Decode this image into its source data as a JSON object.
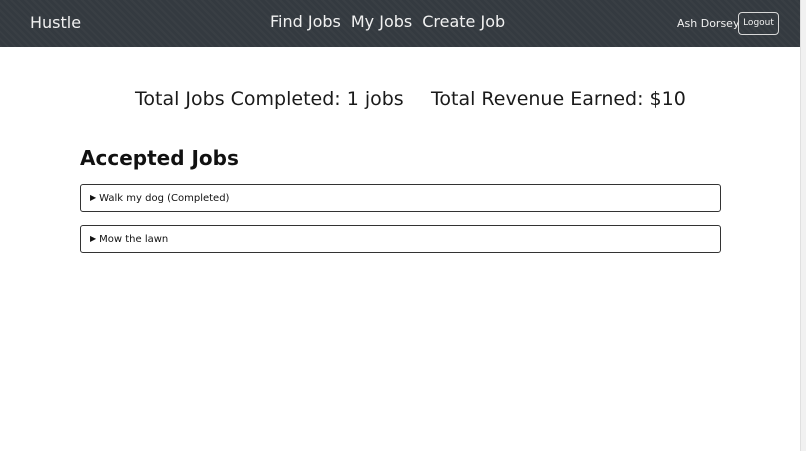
{
  "navbar": {
    "brand": "Hustle",
    "links": [
      {
        "label": "Find Jobs"
      },
      {
        "label": "My Jobs"
      },
      {
        "label": "Create Job"
      }
    ],
    "user_name": "Ash Dorsey",
    "logout_label": "Logout"
  },
  "stats": {
    "jobs_completed": "Total Jobs Completed: 1 jobs",
    "revenue_earned": "Total Revenue Earned: $10"
  },
  "accepted_jobs": {
    "title": "Accepted Jobs",
    "items": [
      {
        "summary": "Walk my dog (Completed)"
      },
      {
        "summary": "Mow the lawn"
      }
    ]
  },
  "colors": {
    "navbar_bg": "#343a40",
    "page_bg": "#ffffff"
  }
}
